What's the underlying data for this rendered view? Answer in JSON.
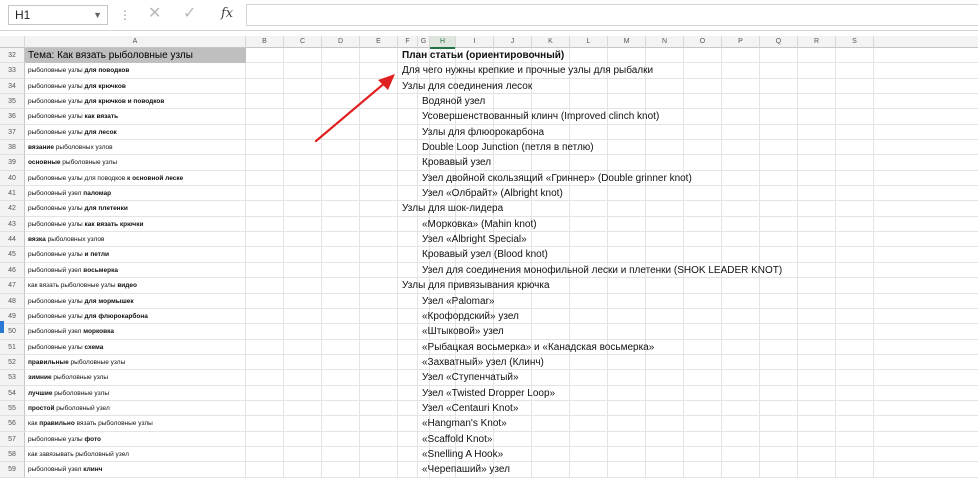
{
  "formula_bar": {
    "name_box": "H1",
    "formula_value": ""
  },
  "column_headers": [
    "A",
    "B",
    "C",
    "D",
    "E",
    "F",
    "G",
    "H",
    "I",
    "J",
    "K",
    "L",
    "M",
    "N",
    "O",
    "P",
    "Q",
    "R",
    "S"
  ],
  "selected_column": "H",
  "rows": [
    {
      "num": "32",
      "a": "Тема: Как вязать рыболовные узлы",
      "a_style": "title",
      "f": "План статьи (ориентировочный)",
      "f_col": "F",
      "f_bold": true
    },
    {
      "num": "33",
      "a": "рыболовные узлы для поводков",
      "a_bold": " для поводков",
      "f": "Для чего нужны крепкие и прочные узлы для рыбалки",
      "f_col": "F"
    },
    {
      "num": "34",
      "a": "рыболовные узлы для крючков",
      "a_bold": " для крючков",
      "f": "Узлы для соединения лесок",
      "f_col": "F"
    },
    {
      "num": "35",
      "a": "рыболовные узлы для крючков и поводков",
      "a_bold": " для крючков и поводков",
      "f": "Водяной узел",
      "f_col": "H"
    },
    {
      "num": "36",
      "a": "рыболовные узлы как вязать",
      "a_bold": " как вязать",
      "f": "Усовершенствованный клинч (Improved clinch knot)",
      "f_col": "H"
    },
    {
      "num": "37",
      "a": "рыболовные узлы для лесок",
      "a_bold": " для лесок",
      "f": "Узлы для флюорокарбона",
      "f_col": "H"
    },
    {
      "num": "38",
      "a": "вязание рыболовных узлов",
      "a_bold": "вязание",
      "f": "Double Loop Junction (петля в петлю)",
      "f_col": "H"
    },
    {
      "num": "39",
      "a": "основные рыболовные узлы",
      "a_bold": "основные",
      "f": "Кровавый узел",
      "f_col": "H"
    },
    {
      "num": "40",
      "a": "рыболовные узлы для поводков к основной леске",
      "a_bold": " к основной леске",
      "f": "Узел двойной скользящий «Гриннер» (Double grinner knot)",
      "f_col": "H"
    },
    {
      "num": "41",
      "a": "рыболовный узел паломар",
      "a_bold": " паломар",
      "f": "Узел «Олбрайт» (Albright knot)",
      "f_col": "H"
    },
    {
      "num": "42",
      "a": "рыболовные узлы для плетенки",
      "a_bold": " для плетенки",
      "f": "Узлы для шок-лидера",
      "f_col": "F"
    },
    {
      "num": "43",
      "a": "рыболовные узлы как вязать крючки",
      "a_bold": " как вязать крючки",
      "f": "«Морковка» (Mahin knot)",
      "f_col": "H"
    },
    {
      "num": "44",
      "a": "вязка рыболовных узлов",
      "a_bold": "вязка",
      "f": "Узел «Albright Special»",
      "f_col": "H"
    },
    {
      "num": "45",
      "a": "рыболовные узлы и петли",
      "a_bold": " и петли",
      "f": "Кровавый узел (Blood knot)",
      "f_col": "H"
    },
    {
      "num": "46",
      "a": "рыболовный узел восьмерка",
      "a_bold": " восьмерка",
      "f": "Узел для соединения монофильной лески и плетенки (SHOK LEADER KNOT)",
      "f_col": "H"
    },
    {
      "num": "47",
      "a": "как вязать рыболовные узлы видео",
      "a_bold": " видео",
      "f": "Узлы для привязывания крючка",
      "f_col": "F"
    },
    {
      "num": "48",
      "a": "рыболовные узлы для мормышек",
      "a_bold": " для мормышек",
      "f": "Узел «Palomar»",
      "f_col": "H"
    },
    {
      "num": "49",
      "a": "рыболовные узлы для флюрокарбона",
      "a_bold": " для флюрокарбона",
      "f": "«Крофордский» узел",
      "f_col": "H"
    },
    {
      "num": "50",
      "a": "рыболовный узел морковка",
      "a_bold": " морковка",
      "f": "«Штыковой» узел",
      "f_col": "H"
    },
    {
      "num": "51",
      "a": "рыболовные узлы схема",
      "a_bold": " схема",
      "f": "«Рыбацкая восьмерка» и «Канадская восьмерка»",
      "f_col": "H"
    },
    {
      "num": "52",
      "a": "правильные рыболовные узлы",
      "a_bold": "правильные",
      "f": "«Захватный» узел (Клинч)",
      "f_col": "H"
    },
    {
      "num": "53",
      "a": "зимние рыболовные узлы",
      "a_bold": "зимние",
      "f": "Узел «Ступенчатый»",
      "f_col": "H"
    },
    {
      "num": "54",
      "a": "лучшие рыболовные узлы",
      "a_bold": "лучшие",
      "f": "Узел «Twisted Dropper Loop»",
      "f_col": "H"
    },
    {
      "num": "55",
      "a": "простой рыболовный узел",
      "a_bold": "простой",
      "f": "Узел «Centauri Knot»",
      "f_col": "H"
    },
    {
      "num": "56",
      "a": "как правильно вязать рыболовные узлы",
      "a_bold": " правильно",
      "f": "«Hangman's Knot»",
      "f_col": "H"
    },
    {
      "num": "57",
      "a": "рыболовные узлы фото",
      "a_bold": " фото",
      "f": "«Scaffold Knot»",
      "f_col": "H"
    },
    {
      "num": "58",
      "a": "как завязывать рыболовный узел",
      "a_bold": "",
      "f": "«Snelling A Hook»",
      "f_col": "H"
    },
    {
      "num": "59",
      "a": "рыболовный узел клинч",
      "a_bold": " клинч",
      "f": "«Черепаший» узел",
      "f_col": "H"
    }
  ],
  "annotation": {
    "color": "#e02020",
    "icon": "red-arrow"
  }
}
